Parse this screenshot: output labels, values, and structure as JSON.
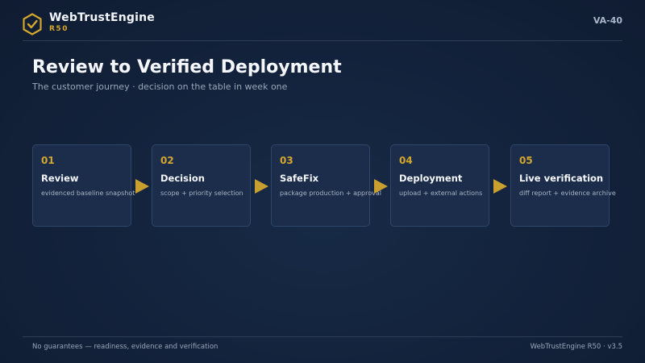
{
  "header": {
    "brand_name": "WebTrustEngine",
    "brand_sub": "R50",
    "slide_id": "VA-40",
    "logo_icon": "shield-check-icon"
  },
  "main": {
    "title": "Review to Verified Deployment",
    "subtitle": "The customer journey · decision on the table in week one"
  },
  "steps": [
    {
      "num": "01",
      "title": "Review",
      "desc": "evidenced baseline snapshot"
    },
    {
      "num": "02",
      "title": "Decision",
      "desc": "scope + priority selection"
    },
    {
      "num": "03",
      "title": "SafeFix",
      "desc": "package production + approval"
    },
    {
      "num": "04",
      "title": "Deployment",
      "desc": "upload + external actions"
    },
    {
      "num": "05",
      "title": "Live verification",
      "desc": "diff report + evidence archive"
    }
  ],
  "footer": {
    "left": "No guarantees — readiness, evidence and verification",
    "right": "WebTrustEngine R50 · v3.5"
  },
  "colors": {
    "background": "#13223b",
    "accent": "#d4a62e",
    "card": "#1b2d4a",
    "card_border": "#2e4668"
  }
}
